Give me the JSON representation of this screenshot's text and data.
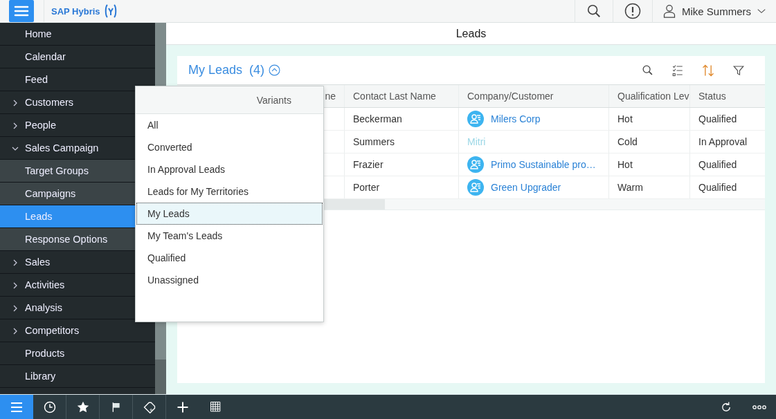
{
  "header": {
    "brand": "SAP Hybris",
    "user": "Mike Summers"
  },
  "sidebar": {
    "items": [
      {
        "label": "Home",
        "kind": "link",
        "selected": false
      },
      {
        "label": "Calendar",
        "kind": "link",
        "selected": false
      },
      {
        "label": "Feed",
        "kind": "link",
        "selected": false
      },
      {
        "label": "Customers",
        "kind": "group",
        "expanded": false,
        "selected": false
      },
      {
        "label": "People",
        "kind": "group",
        "expanded": false,
        "selected": false
      },
      {
        "label": "Sales Campaign",
        "kind": "group",
        "expanded": true,
        "selected": false,
        "children": [
          {
            "label": "Target Groups",
            "selected": false
          },
          {
            "label": "Campaigns",
            "selected": false
          },
          {
            "label": "Leads",
            "selected": true
          },
          {
            "label": "Response Options",
            "selected": false
          }
        ]
      },
      {
        "label": "Sales",
        "kind": "group",
        "expanded": false,
        "selected": false
      },
      {
        "label": "Activities",
        "kind": "group",
        "expanded": false,
        "selected": false
      },
      {
        "label": "Analysis",
        "kind": "group",
        "expanded": false,
        "selected": false
      },
      {
        "label": "Competitors",
        "kind": "group",
        "expanded": false,
        "selected": false
      },
      {
        "label": "Products",
        "kind": "link",
        "selected": false
      },
      {
        "label": "Library",
        "kind": "link",
        "selected": false
      }
    ]
  },
  "page_title": "Leads",
  "list": {
    "title": "My Leads",
    "count": "(4)",
    "columns": [
      "ne",
      "Contact Last Name",
      "Company/Customer",
      "Qualification Lev",
      "Status"
    ],
    "rows": [
      {
        "last_name": "Beckerman",
        "company": {
          "text": "Milers Corp",
          "kind": "account"
        },
        "qualification": "Hot",
        "status": "Qualified"
      },
      {
        "last_name": "Summers",
        "company": {
          "text": "Mitri",
          "kind": "faded"
        },
        "qualification": "Cold",
        "status": "In Approval"
      },
      {
        "last_name": "Frazier",
        "company": {
          "text": "Primo Sustainable pro…",
          "kind": "account"
        },
        "qualification": "Hot",
        "status": "Qualified"
      },
      {
        "last_name": "Porter",
        "company": {
          "text": "Green Upgrader",
          "kind": "account"
        },
        "qualification": "Warm",
        "status": "Qualified"
      }
    ]
  },
  "variants": {
    "title": "Variants",
    "items": [
      {
        "label": "All",
        "selected": false
      },
      {
        "label": "Converted",
        "selected": false
      },
      {
        "label": "In Approval Leads",
        "selected": false
      },
      {
        "label": "Leads for My Territories",
        "selected": false
      },
      {
        "label": "My Leads",
        "selected": true
      },
      {
        "label": "My Team's Leads",
        "selected": false
      },
      {
        "label": "Qualified",
        "selected": false
      },
      {
        "label": "Unassigned",
        "selected": false
      }
    ]
  }
}
